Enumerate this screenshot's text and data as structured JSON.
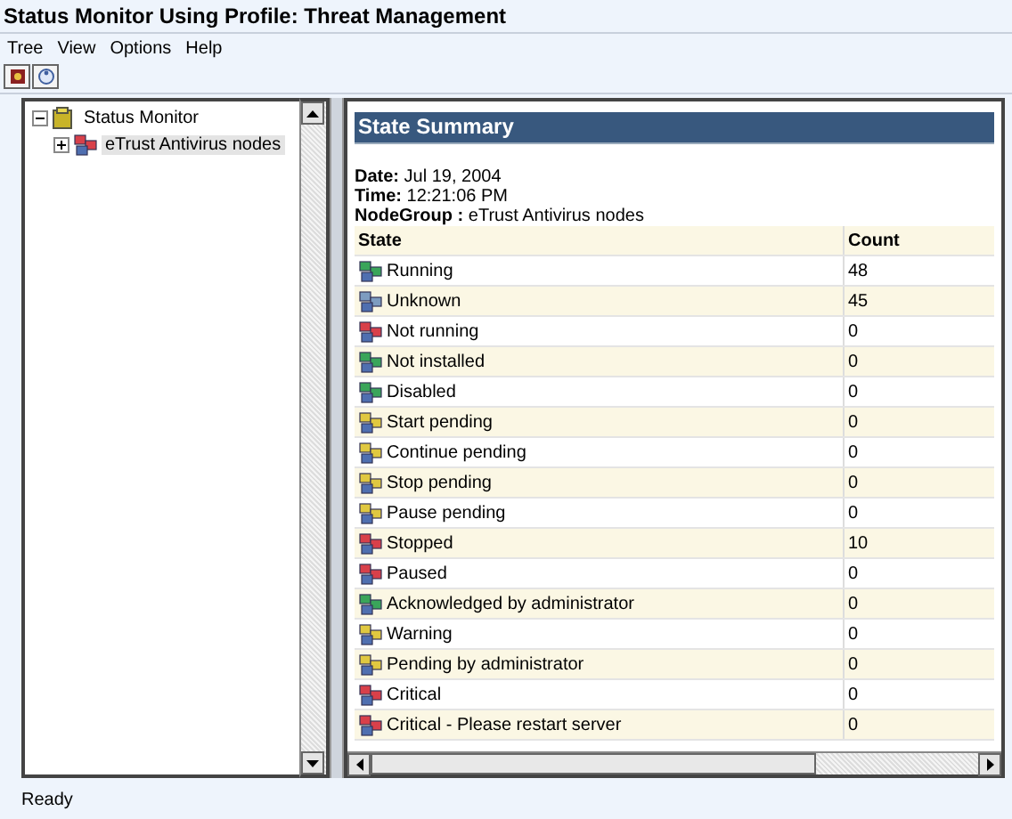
{
  "window": {
    "title": "Status Monitor Using Profile: Threat Management"
  },
  "menu": [
    "Tree",
    "View",
    "Options",
    "Help"
  ],
  "tree": [
    {
      "label": "Status Monitor",
      "expanded": true,
      "selected": false,
      "children": [
        {
          "label": "eTrust Antivirus nodes",
          "expanded": false,
          "selected": true
        }
      ]
    }
  ],
  "summary": {
    "title": "State Summary",
    "details": [
      {
        "label": "Date:",
        "value": "Jul 19, 2004"
      },
      {
        "label": "Time:",
        "value": "12:21:06 PM"
      },
      {
        "label": "NodeGroup :",
        "value": "eTrust Antivirus nodes"
      }
    ],
    "columns": [
      "State",
      "Count"
    ],
    "rows": [
      {
        "state": "Running",
        "count": "48",
        "color": "#3aa55a"
      },
      {
        "state": "Unknown",
        "count": "45",
        "color": "#7d9cc0"
      },
      {
        "state": "Not running",
        "count": "0",
        "color": "#d8404a"
      },
      {
        "state": "Not installed",
        "count": "0",
        "color": "#3aa55a"
      },
      {
        "state": "Disabled",
        "count": "0",
        "color": "#3aa55a"
      },
      {
        "state": "Start pending",
        "count": "0",
        "color": "#e0c840"
      },
      {
        "state": "Continue pending",
        "count": "0",
        "color": "#e0c840"
      },
      {
        "state": "Stop pending",
        "count": "0",
        "color": "#e0c840"
      },
      {
        "state": "Pause pending",
        "count": "0",
        "color": "#e0c840"
      },
      {
        "state": "Stopped",
        "count": "10",
        "color": "#d8404a"
      },
      {
        "state": "Paused",
        "count": "0",
        "color": "#d8404a"
      },
      {
        "state": "Acknowledged by administrator",
        "count": "0",
        "color": "#3aa55a"
      },
      {
        "state": "Warning",
        "count": "0",
        "color": "#e0c840"
      },
      {
        "state": "Pending by administrator",
        "count": "0",
        "color": "#e0c840"
      },
      {
        "state": "Critical",
        "count": "0",
        "color": "#d8404a"
      },
      {
        "state": "Critical - Please restart server",
        "count": "0",
        "color": "#d8404a"
      }
    ]
  },
  "status_bar": "Ready"
}
